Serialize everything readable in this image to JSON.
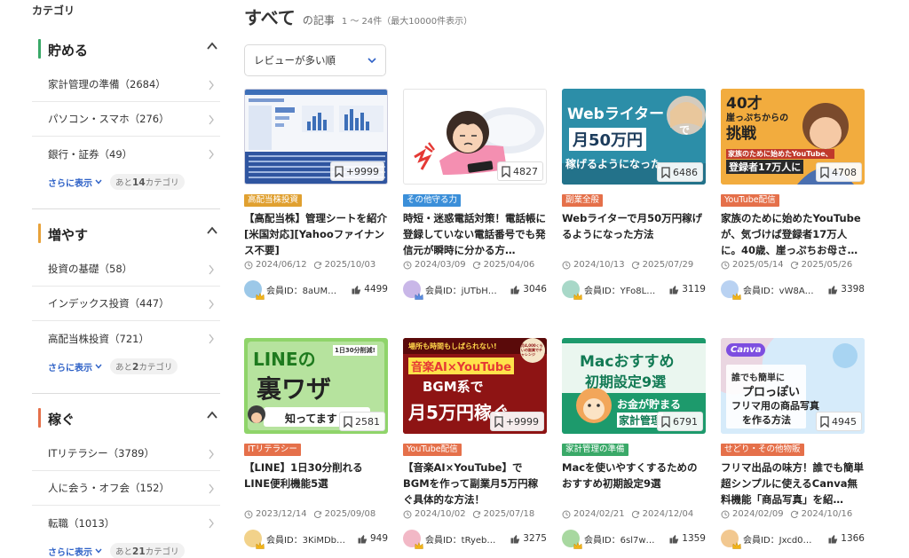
{
  "sidebar": {
    "heading": "カテゴリ",
    "sections": [
      {
        "title": "貯める",
        "accent": "#3aa968",
        "items": [
          "家計管理の準備（2684）",
          "パソコン・スマホ（276）",
          "銀行・証券（49）"
        ],
        "more_label": "さらに表示",
        "rest_prefix": "あと",
        "rest_count": "14",
        "rest_suffix": "カテゴリ"
      },
      {
        "title": "増やす",
        "accent": "#e8a23a",
        "items": [
          "投資の基礎（58）",
          "インデックス投資（447）",
          "高配当株投資（721）"
        ],
        "more_label": "さらに表示",
        "rest_prefix": "あと",
        "rest_count": "2",
        "rest_suffix": "カテゴリ"
      },
      {
        "title": "稼ぐ",
        "accent": "#e5704a",
        "items": [
          "ITリテラシー（3789）",
          "人に会う・オフ会（152）",
          "転職（1013）"
        ],
        "more_label": "さらに表示",
        "rest_prefix": "あと",
        "rest_count": "21",
        "rest_suffix": "カテゴリ"
      }
    ]
  },
  "main": {
    "title": "すべて",
    "title_suffix": "の記事",
    "range": "1 ～ 24件（最大10000件表示）",
    "sort_value": "レビューが多い順"
  },
  "thumb_texts": {
    "c3_line1": "Webライター",
    "c3_de": "で",
    "c3_line2": "月50万円",
    "c3_line3": "稼げるようになった",
    "c4_line1": "40才",
    "c4_line2": "崖っぷちからの",
    "c4_line3": "挑戦",
    "c4_line4": "家族のために始めたYouTube、",
    "c4_line5": "登録者17万人に",
    "c5_line1": "LINEの",
    "c5_badge": "1日30分削減!",
    "c5_line2": "裏ワザ",
    "c5_line3": "知ってます",
    "c6_line1": "場所も時間もしばられない!",
    "c6_line2": "音楽AI×YouTube",
    "c6_line3": "BGM系で",
    "c6_line4": "月5万円稼ぐ",
    "c6_badge": "月4,000くらいの副業でチャレンジ",
    "c7_line1": "Macおすすめ",
    "c7_line2": "初期設定9選",
    "c7_line3": "お金が貯まる",
    "c7_line4": "家計管理",
    "c8_logo": "Canva",
    "c8_line1": "誰でも簡単に",
    "c8_line2": "プロっぽい",
    "c8_line3": "フリマ用の商品写真",
    "c8_line4": "を作る方法"
  },
  "cards": [
    {
      "bookmarks": "+9999",
      "tag": "高配当株投資",
      "tag_color": "#e0a030",
      "title": "【高配当株】管理シートを紹介 [米国対応][Yahooファイナンス不要]",
      "created": "2024/06/12",
      "updated": "2025/10/03",
      "user": "会員ID：8aUM…",
      "likes": "4499"
    },
    {
      "bookmarks": "4827",
      "tag": "その他守る力",
      "tag_color": "#3b8fd9",
      "title": "時短・迷惑電話対策！電話帳に登録していない電話番号でも発信元が瞬時に分かる方…",
      "created": "2024/03/09",
      "updated": "2025/04/06",
      "user": "会員ID：jUTbH…",
      "likes": "3046"
    },
    {
      "bookmarks": "6486",
      "tag": "副業全般",
      "tag_color": "#e5704a",
      "title": "Webライターで月50万円稼げるようになった方法",
      "created": "2024/10/13",
      "updated": "2025/07/29",
      "user": "会員ID：YFo8L…",
      "likes": "3119"
    },
    {
      "bookmarks": "4708",
      "tag": "YouTube配信",
      "tag_color": "#e5704a",
      "title": "家族のために始めたYouTubeが、気づけば登録者17万人に。40歳、崖っぷちお母さ…",
      "created": "2025/05/14",
      "updated": "2025/05/26",
      "user": "会員ID：vW8A…",
      "likes": "3398"
    },
    {
      "bookmarks": "2581",
      "tag": "ITリテラシー",
      "tag_color": "#e5704a",
      "title": "【LINE】1日30分削れるLINE便利機能5選",
      "created": "2023/12/14",
      "updated": "2025/09/08",
      "user": "会員ID：3KiMDb…",
      "likes": "949"
    },
    {
      "bookmarks": "+9999",
      "tag": "YouTube配信",
      "tag_color": "#e5704a",
      "title": "【音楽AI×YouTube】でBGMを作って副業月5万円稼ぐ具体的な方法！",
      "created": "2024/10/02",
      "updated": "2025/07/18",
      "user": "会員ID：tRyeb…",
      "likes": "3275"
    },
    {
      "bookmarks": "6791",
      "tag": "家計管理の準備",
      "tag_color": "#3aa968",
      "title": "Macを使いやすくするためのおすすめ初期設定9選",
      "created": "2024/02/21",
      "updated": "2024/12/04",
      "user": "会員ID：6sl7w…",
      "likes": "1359"
    },
    {
      "bookmarks": "4945",
      "tag": "せどり・その他物販",
      "tag_color": "#e5704a",
      "title": "フリマ出品の味方！誰でも簡単超シンプルに使えるCanva無料機能「商品写真」を紹…",
      "created": "2024/02/09",
      "updated": "2024/10/16",
      "user": "会員ID：Jxcd0…",
      "likes": "1366"
    }
  ]
}
